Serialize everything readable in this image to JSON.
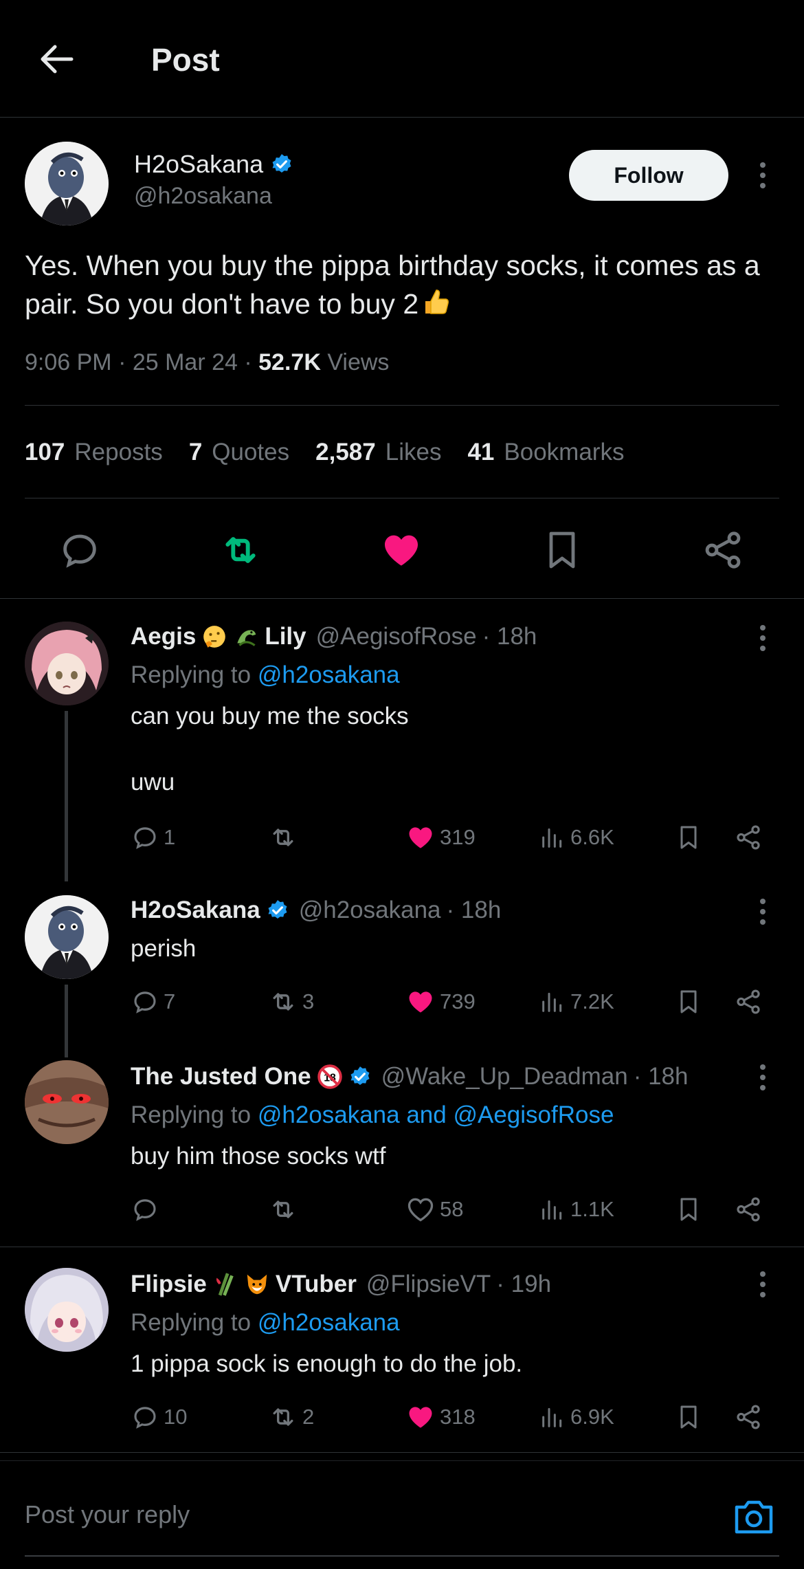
{
  "header": {
    "title": "Post"
  },
  "post": {
    "author_name": "H2oSakana",
    "author_handle": "@h2osakana",
    "follow_label": "Follow",
    "text": "Yes. When you buy the pippa birthday socks, it comes as a pair. So you don't have to buy 2",
    "time": "9:06 PM · 25 Mar 24 · ",
    "views_count": "52.7K",
    "views_label": " Views",
    "stats": [
      {
        "count": "107",
        "label": "Reposts"
      },
      {
        "count": "7",
        "label": "Quotes"
      },
      {
        "count": "2,587",
        "label": "Likes"
      },
      {
        "count": "41",
        "label": "Bookmarks"
      }
    ],
    "colors": {
      "like": "#f91880",
      "repost": "#00ba7c",
      "link": "#1d9bf0"
    }
  },
  "replies": [
    {
      "name_a": "Aegis",
      "name_b": "Lily",
      "handle": "@AegisofRose",
      "time": "· 18h",
      "replying_prefix": "Replying to ",
      "replying_to": "@h2osakana",
      "text_line1": "can you buy me the socks",
      "text_line2": "uwu",
      "replies": "1",
      "reposts": "",
      "likes": "319",
      "views": "6.6K"
    },
    {
      "name_a": "H2oSakana",
      "handle": "@h2osakana",
      "time": "· 18h",
      "text_line1": "perish",
      "replies": "7",
      "reposts": "3",
      "likes": "739",
      "views": "7.2K"
    },
    {
      "name_a": "The Justed One",
      "handle": "@Wake_Up_Deadman",
      "time": "· 18h",
      "replying_prefix": "Replying to ",
      "replying_to": "@h2osakana and @AegisofRose",
      "text_line1": "buy him those socks wtf",
      "replies": "",
      "reposts": "",
      "likes": "58",
      "views": "1.1K"
    },
    {
      "name_a": "Flipsie",
      "name_b": "VTuber",
      "handle": "@FlipsieVT",
      "time": "· 19h",
      "replying_prefix": "Replying to ",
      "replying_to": "@h2osakana",
      "text_line1": "1 pippa sock is enough to do the job.",
      "replies": "10",
      "reposts": "2",
      "likes": "318",
      "views": "6.9K"
    }
  ],
  "reply_box": {
    "placeholder": "Post your reply"
  }
}
